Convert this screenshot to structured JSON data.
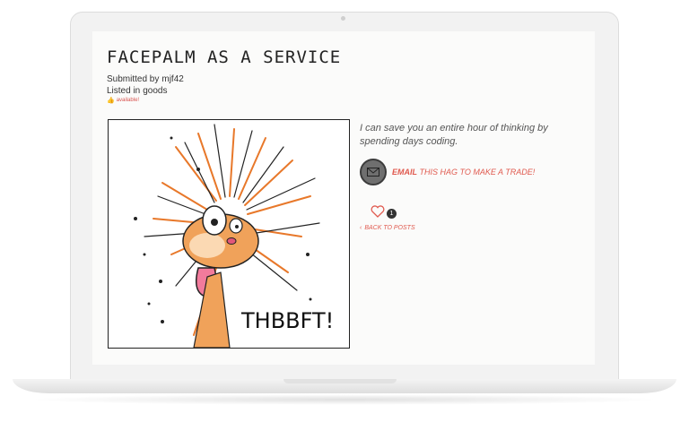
{
  "post": {
    "title": "Facepalm as a Service",
    "submitted_prefix": "Submitted by",
    "author": "mjf42",
    "listed_prefix": "Listed in",
    "category": "goods",
    "availability": "available!",
    "image_caption": "THBBFT!",
    "description": "I can save you an entire hour of thinking by spending days coding.",
    "email_label": "EMAIL",
    "email_suffix": "THIS HAG TO MAKE A TRADE!",
    "likes": "1",
    "back_label": "BACK TO POSTS"
  },
  "icons": {
    "thumb": "thumbs-up-icon",
    "email": "envelope-icon",
    "like": "heart-icon",
    "back": "chevron-left-icon"
  },
  "colors": {
    "accent": "#e05a4f",
    "email_circle": "#6f6f6f",
    "cat_orange": "#e8782a"
  }
}
